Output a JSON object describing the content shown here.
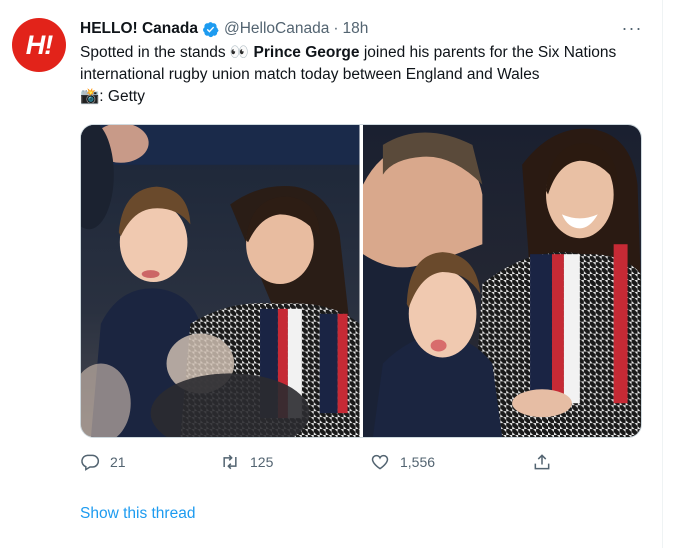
{
  "tweet": {
    "avatar_text": "H!",
    "display_name": "HELLO! Canada",
    "handle": "@HelloCanada",
    "separator": "·",
    "time": "18h",
    "more_label": "···",
    "text_part1": "Spotted in the stands 👀 ",
    "text_bold": "Prince George",
    "text_part2": " joined his parents for the Six Nations international rugby union match today between England and Wales",
    "text_credit": "📸: Getty",
    "photos": [
      "photo-1",
      "photo-2"
    ]
  },
  "actions": {
    "reply_count": "21",
    "retweet_count": "125",
    "like_count": "1,556"
  },
  "show_thread": "Show this thread",
  "colors": {
    "brand_red": "#e2231a",
    "link_blue": "#1d9bf0",
    "muted_gray": "#536471",
    "verified_blue": "#1d9bf0"
  },
  "icons": [
    "verified-badge-icon",
    "more-icon",
    "reply-icon",
    "retweet-icon",
    "like-icon",
    "share-icon"
  ]
}
